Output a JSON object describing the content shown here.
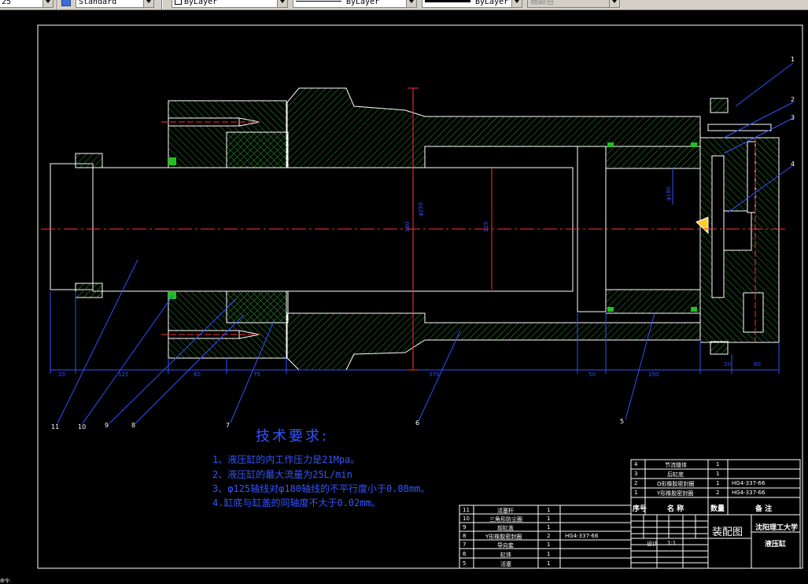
{
  "toolbar": {
    "linetype_scale": "25",
    "text_style": "Standard",
    "color": "ByLayer",
    "linetype": "ByLayer",
    "lineweight": "ByLayer",
    "plot_style": "随颜色"
  },
  "drawing": {
    "balloons": [
      "1",
      "2",
      "3",
      "4",
      "5",
      "6",
      "7",
      "8",
      "9",
      "10",
      "11"
    ],
    "dimensions": {
      "d1": "20",
      "d2": "125",
      "d3": "60",
      "d4": "75",
      "d5": "370",
      "d6": "50",
      "d7": "150",
      "d8": "20",
      "d9": "60",
      "v1": "φ250",
      "v2": "180",
      "v3": "125",
      "v4": "φ180"
    },
    "tech_title": "技术要求:",
    "tech_lines": [
      "1、液压缸的内工作压力是21Mpa。",
      "2、液压缸的最大流量为25L/min",
      "3、φ125轴线对φ180轴线的不平行度小于0.08mm。",
      "4.缸底与缸盖的同轴度不大于0.02mm。"
    ]
  },
  "bom_upper": {
    "rows": [
      {
        "no": "4",
        "name": "节流缝体",
        "qty": "1",
        "note": ""
      },
      {
        "no": "3",
        "name": "后缸底",
        "qty": "1",
        "note": ""
      },
      {
        "no": "2",
        "name": "O形橡胶密封圈",
        "qty": "1",
        "note": "HG4-337-66"
      },
      {
        "no": "1",
        "name": "Y形橡胶密封圈",
        "qty": "2",
        "note": "HG4-337-66"
      }
    ],
    "header": {
      "no": "序号",
      "name": "名 称",
      "qty": "数量",
      "note": "备 注"
    }
  },
  "bom_lower": {
    "rows": [
      {
        "no": "11",
        "name": "活塞杆",
        "qty": "1",
        "note": ""
      },
      {
        "no": "10",
        "name": "三角形防尘圈",
        "qty": "1",
        "note": ""
      },
      {
        "no": "9",
        "name": "前缸盖",
        "qty": "1",
        "note": ""
      },
      {
        "no": "8",
        "name": "Y形橡胶密封圈",
        "qty": "2",
        "note": "HG4-337-66"
      },
      {
        "no": "7",
        "name": "导向套",
        "qty": "1",
        "note": ""
      },
      {
        "no": "6",
        "name": "缸体",
        "qty": "1",
        "note": ""
      },
      {
        "no": "5",
        "name": "活塞",
        "qty": "1",
        "note": ""
      }
    ]
  },
  "title_block": {
    "drawing_type": "装配图",
    "school": "沈阳理工大学",
    "part_name": "液压缸",
    "role_label": "设计",
    "scale_label": "1:1"
  },
  "command_line": "命令:"
}
